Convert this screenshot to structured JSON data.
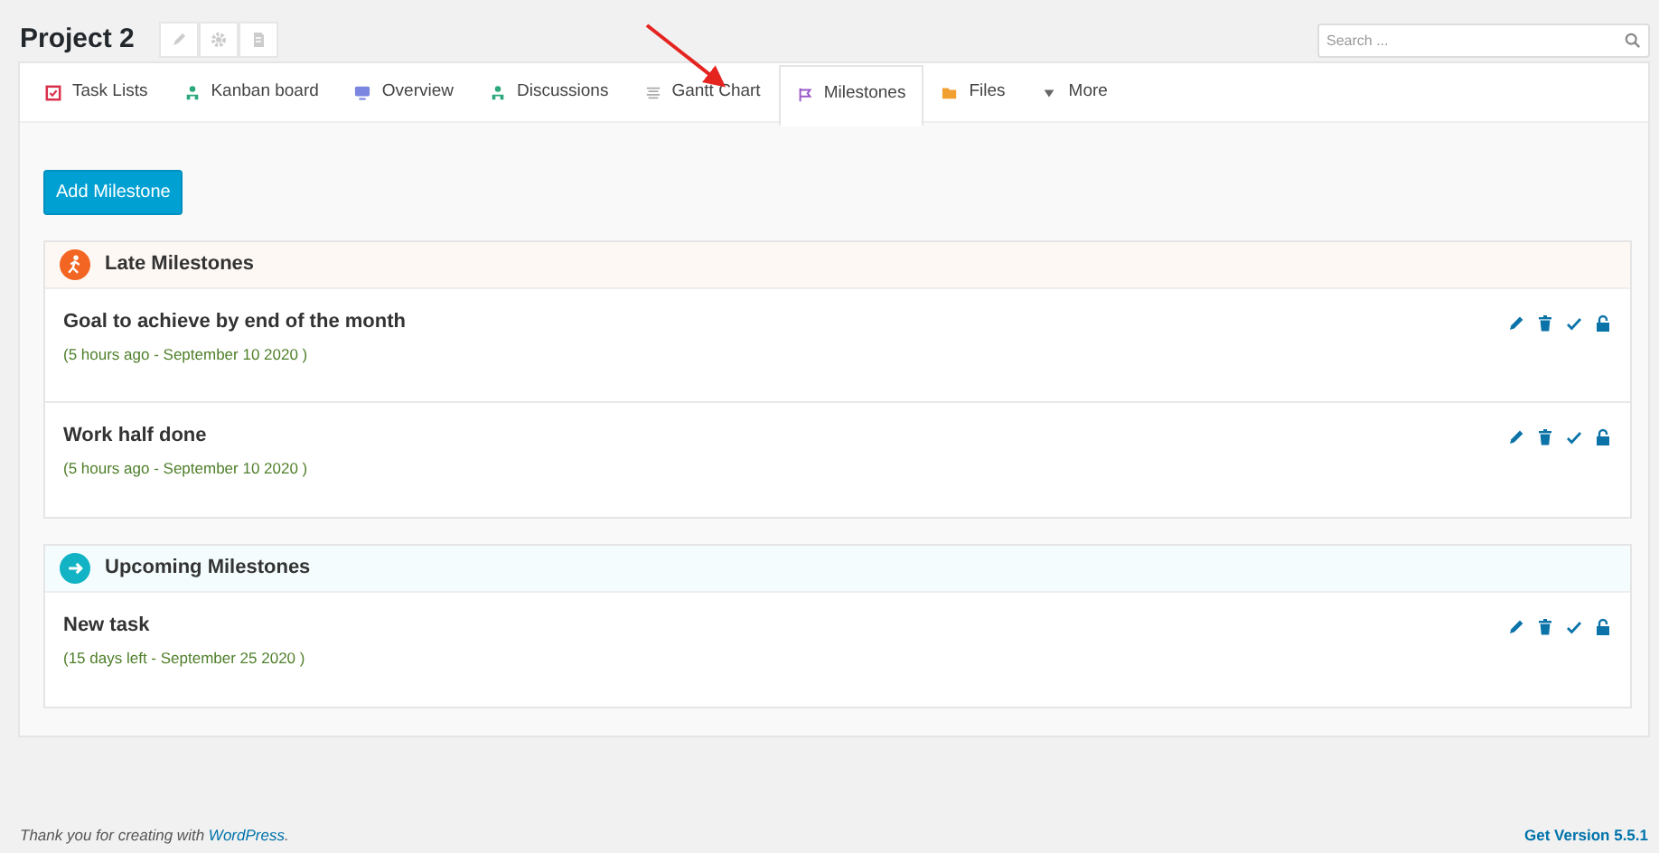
{
  "project": {
    "title": "Project 2"
  },
  "search": {
    "placeholder": "Search ..."
  },
  "tabs": [
    {
      "label": "Task Lists",
      "selected": false
    },
    {
      "label": "Kanban board",
      "selected": false
    },
    {
      "label": "Overview",
      "selected": false
    },
    {
      "label": "Discussions",
      "selected": false
    },
    {
      "label": "Gantt Chart",
      "selected": false
    },
    {
      "label": "Milestones",
      "selected": true
    },
    {
      "label": "Files",
      "selected": false
    },
    {
      "label": "More",
      "selected": false
    }
  ],
  "add_button": "Add Milestone",
  "sections": [
    {
      "kind": "late",
      "title": "Late Milestones",
      "items": [
        {
          "title": "Goal to achieve by end of the month",
          "meta": "(5 hours ago - September 10 2020 )"
        },
        {
          "title": "Work half done",
          "meta": "(5 hours ago - September 10 2020 )"
        }
      ]
    },
    {
      "kind": "upcoming",
      "title": "Upcoming Milestones",
      "items": [
        {
          "title": "New task",
          "meta": "(15 days left - September 25 2020 )"
        }
      ]
    }
  ],
  "footer": {
    "text": "Thank you for creating with ",
    "link": "WordPress",
    "after": ".",
    "version": "Get Version 5.5.1"
  }
}
